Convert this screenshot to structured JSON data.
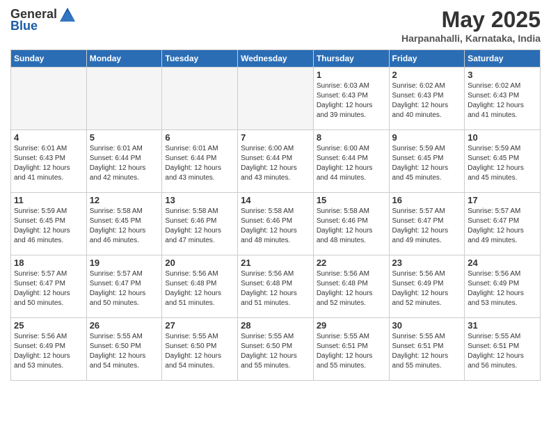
{
  "header": {
    "logo_general": "General",
    "logo_blue": "Blue",
    "title": "May 2025",
    "location": "Harpanahalli, Karnataka, India"
  },
  "calendar": {
    "days_of_week": [
      "Sunday",
      "Monday",
      "Tuesday",
      "Wednesday",
      "Thursday",
      "Friday",
      "Saturday"
    ],
    "weeks": [
      [
        {
          "day": "",
          "info": ""
        },
        {
          "day": "",
          "info": ""
        },
        {
          "day": "",
          "info": ""
        },
        {
          "day": "",
          "info": ""
        },
        {
          "day": "1",
          "info": "Sunrise: 6:03 AM\nSunset: 6:43 PM\nDaylight: 12 hours\nand 39 minutes."
        },
        {
          "day": "2",
          "info": "Sunrise: 6:02 AM\nSunset: 6:43 PM\nDaylight: 12 hours\nand 40 minutes."
        },
        {
          "day": "3",
          "info": "Sunrise: 6:02 AM\nSunset: 6:43 PM\nDaylight: 12 hours\nand 41 minutes."
        }
      ],
      [
        {
          "day": "4",
          "info": "Sunrise: 6:01 AM\nSunset: 6:43 PM\nDaylight: 12 hours\nand 41 minutes."
        },
        {
          "day": "5",
          "info": "Sunrise: 6:01 AM\nSunset: 6:44 PM\nDaylight: 12 hours\nand 42 minutes."
        },
        {
          "day": "6",
          "info": "Sunrise: 6:01 AM\nSunset: 6:44 PM\nDaylight: 12 hours\nand 43 minutes."
        },
        {
          "day": "7",
          "info": "Sunrise: 6:00 AM\nSunset: 6:44 PM\nDaylight: 12 hours\nand 43 minutes."
        },
        {
          "day": "8",
          "info": "Sunrise: 6:00 AM\nSunset: 6:44 PM\nDaylight: 12 hours\nand 44 minutes."
        },
        {
          "day": "9",
          "info": "Sunrise: 5:59 AM\nSunset: 6:45 PM\nDaylight: 12 hours\nand 45 minutes."
        },
        {
          "day": "10",
          "info": "Sunrise: 5:59 AM\nSunset: 6:45 PM\nDaylight: 12 hours\nand 45 minutes."
        }
      ],
      [
        {
          "day": "11",
          "info": "Sunrise: 5:59 AM\nSunset: 6:45 PM\nDaylight: 12 hours\nand 46 minutes."
        },
        {
          "day": "12",
          "info": "Sunrise: 5:58 AM\nSunset: 6:45 PM\nDaylight: 12 hours\nand 46 minutes."
        },
        {
          "day": "13",
          "info": "Sunrise: 5:58 AM\nSunset: 6:46 PM\nDaylight: 12 hours\nand 47 minutes."
        },
        {
          "day": "14",
          "info": "Sunrise: 5:58 AM\nSunset: 6:46 PM\nDaylight: 12 hours\nand 48 minutes."
        },
        {
          "day": "15",
          "info": "Sunrise: 5:58 AM\nSunset: 6:46 PM\nDaylight: 12 hours\nand 48 minutes."
        },
        {
          "day": "16",
          "info": "Sunrise: 5:57 AM\nSunset: 6:47 PM\nDaylight: 12 hours\nand 49 minutes."
        },
        {
          "day": "17",
          "info": "Sunrise: 5:57 AM\nSunset: 6:47 PM\nDaylight: 12 hours\nand 49 minutes."
        }
      ],
      [
        {
          "day": "18",
          "info": "Sunrise: 5:57 AM\nSunset: 6:47 PM\nDaylight: 12 hours\nand 50 minutes."
        },
        {
          "day": "19",
          "info": "Sunrise: 5:57 AM\nSunset: 6:47 PM\nDaylight: 12 hours\nand 50 minutes."
        },
        {
          "day": "20",
          "info": "Sunrise: 5:56 AM\nSunset: 6:48 PM\nDaylight: 12 hours\nand 51 minutes."
        },
        {
          "day": "21",
          "info": "Sunrise: 5:56 AM\nSunset: 6:48 PM\nDaylight: 12 hours\nand 51 minutes."
        },
        {
          "day": "22",
          "info": "Sunrise: 5:56 AM\nSunset: 6:48 PM\nDaylight: 12 hours\nand 52 minutes."
        },
        {
          "day": "23",
          "info": "Sunrise: 5:56 AM\nSunset: 6:49 PM\nDaylight: 12 hours\nand 52 minutes."
        },
        {
          "day": "24",
          "info": "Sunrise: 5:56 AM\nSunset: 6:49 PM\nDaylight: 12 hours\nand 53 minutes."
        }
      ],
      [
        {
          "day": "25",
          "info": "Sunrise: 5:56 AM\nSunset: 6:49 PM\nDaylight: 12 hours\nand 53 minutes."
        },
        {
          "day": "26",
          "info": "Sunrise: 5:55 AM\nSunset: 6:50 PM\nDaylight: 12 hours\nand 54 minutes."
        },
        {
          "day": "27",
          "info": "Sunrise: 5:55 AM\nSunset: 6:50 PM\nDaylight: 12 hours\nand 54 minutes."
        },
        {
          "day": "28",
          "info": "Sunrise: 5:55 AM\nSunset: 6:50 PM\nDaylight: 12 hours\nand 55 minutes."
        },
        {
          "day": "29",
          "info": "Sunrise: 5:55 AM\nSunset: 6:51 PM\nDaylight: 12 hours\nand 55 minutes."
        },
        {
          "day": "30",
          "info": "Sunrise: 5:55 AM\nSunset: 6:51 PM\nDaylight: 12 hours\nand 55 minutes."
        },
        {
          "day": "31",
          "info": "Sunrise: 5:55 AM\nSunset: 6:51 PM\nDaylight: 12 hours\nand 56 minutes."
        }
      ]
    ]
  }
}
